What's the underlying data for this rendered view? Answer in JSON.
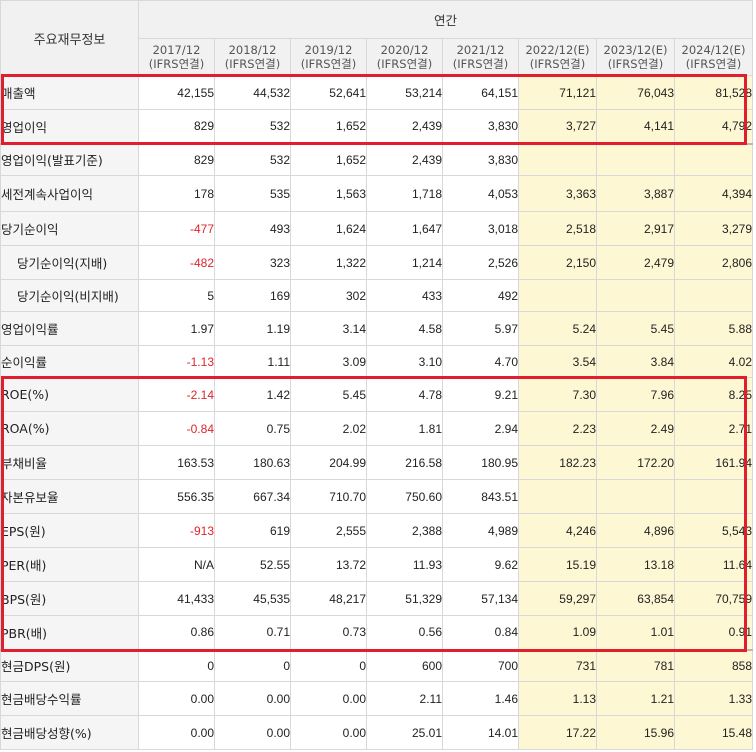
{
  "header": {
    "corner_label": "주요재무정보",
    "annual_label": "연간",
    "years": [
      {
        "year": "2017/12",
        "basis": "(IFRS연결)"
      },
      {
        "year": "2018/12",
        "basis": "(IFRS연결)"
      },
      {
        "year": "2019/12",
        "basis": "(IFRS연결)"
      },
      {
        "year": "2020/12",
        "basis": "(IFRS연결)"
      },
      {
        "year": "2021/12",
        "basis": "(IFRS연결)"
      },
      {
        "year": "2022/12(E)",
        "basis": "(IFRS연결)"
      },
      {
        "year": "2023/12(E)",
        "basis": "(IFRS연결)"
      },
      {
        "year": "2024/12(E)",
        "basis": "(IFRS연결)"
      }
    ]
  },
  "rows": [
    {
      "label": "매출액",
      "values": [
        "42,155",
        "44,532",
        "52,641",
        "53,214",
        "64,151",
        "71,121",
        "76,043",
        "81,528"
      ]
    },
    {
      "label": "영업이익",
      "values": [
        "829",
        "532",
        "1,652",
        "2,439",
        "3,830",
        "3,727",
        "4,141",
        "4,792"
      ]
    },
    {
      "label": "영업이익(발표기준)",
      "values": [
        "829",
        "532",
        "1,652",
        "2,439",
        "3,830",
        "",
        "",
        ""
      ]
    },
    {
      "label": "세전계속사업이익",
      "values": [
        "178",
        "535",
        "1,563",
        "1,718",
        "4,053",
        "3,363",
        "3,887",
        "4,394"
      ]
    },
    {
      "label": "당기순이익",
      "values": [
        "-477",
        "493",
        "1,624",
        "1,647",
        "3,018",
        "2,518",
        "2,917",
        "3,279"
      ]
    },
    {
      "label": "당기순이익(지배)",
      "sub": true,
      "values": [
        "-482",
        "323",
        "1,322",
        "1,214",
        "2,526",
        "2,150",
        "2,479",
        "2,806"
      ]
    },
    {
      "label": "당기순이익(비지배)",
      "sub": true,
      "values": [
        "5",
        "169",
        "302",
        "433",
        "492",
        "",
        "",
        ""
      ]
    },
    {
      "label": "영업이익률",
      "values": [
        "1.97",
        "1.19",
        "3.14",
        "4.58",
        "5.97",
        "5.24",
        "5.45",
        "5.88"
      ]
    },
    {
      "label": "순이익률",
      "values": [
        "-1.13",
        "1.11",
        "3.09",
        "3.10",
        "4.70",
        "3.54",
        "3.84",
        "4.02"
      ]
    },
    {
      "label": "ROE(%)",
      "values": [
        "-2.14",
        "1.42",
        "5.45",
        "4.78",
        "9.21",
        "7.30",
        "7.96",
        "8.25"
      ]
    },
    {
      "label": "ROA(%)",
      "values": [
        "-0.84",
        "0.75",
        "2.02",
        "1.81",
        "2.94",
        "2.23",
        "2.49",
        "2.71"
      ]
    },
    {
      "label": "부채비율",
      "values": [
        "163.53",
        "180.63",
        "204.99",
        "216.58",
        "180.95",
        "182.23",
        "172.20",
        "161.94"
      ]
    },
    {
      "label": "자본유보율",
      "values": [
        "556.35",
        "667.34",
        "710.70",
        "750.60",
        "843.51",
        "",
        "",
        ""
      ]
    },
    {
      "label": "EPS(원)",
      "values": [
        "-913",
        "619",
        "2,555",
        "2,388",
        "4,989",
        "4,246",
        "4,896",
        "5,543"
      ]
    },
    {
      "label": "PER(배)",
      "values": [
        "N/A",
        "52.55",
        "13.72",
        "11.93",
        "9.62",
        "15.19",
        "13.18",
        "11.64"
      ]
    },
    {
      "label": "BPS(원)",
      "values": [
        "41,433",
        "45,535",
        "48,217",
        "51,329",
        "57,134",
        "59,297",
        "63,854",
        "70,759"
      ]
    },
    {
      "label": "PBR(배)",
      "values": [
        "0.86",
        "0.71",
        "0.73",
        "0.56",
        "0.84",
        "1.09",
        "1.01",
        "0.91"
      ]
    },
    {
      "label": "현금DPS(원)",
      "values": [
        "0",
        "0",
        "0",
        "600",
        "700",
        "731",
        "781",
        "858"
      ]
    },
    {
      "label": "현금배당수익률",
      "values": [
        "0.00",
        "0.00",
        "0.00",
        "2.11",
        "1.46",
        "1.13",
        "1.21",
        "1.33"
      ]
    },
    {
      "label": "현금배당성향(%)",
      "values": [
        "0.00",
        "0.00",
        "0.00",
        "25.01",
        "14.01",
        "17.22",
        "15.96",
        "15.48"
      ]
    }
  ],
  "colors": {
    "highlight_border": "#e01e2e",
    "estimate_bg": "#fdf7d4",
    "negative_text": "#e0242a",
    "header_bg": "#f1f1f1"
  }
}
